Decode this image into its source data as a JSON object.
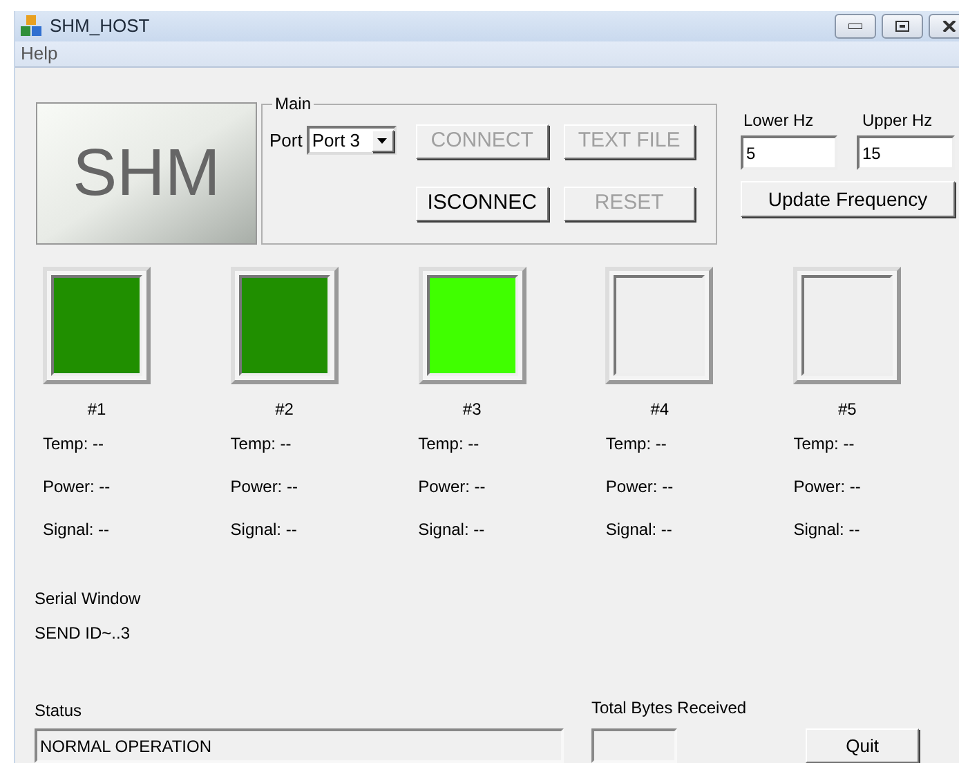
{
  "window": {
    "title": "SHM_HOST"
  },
  "menu": [
    "Help"
  ],
  "logo_button": {
    "label": "SHM"
  },
  "main_group": {
    "title": "Main",
    "port_label": "Port",
    "port_value": "Port 3",
    "buttons": [
      {
        "label": "CONNECT",
        "disabled": true
      },
      {
        "label": "TEXT FILE",
        "disabled": true
      },
      {
        "label": "ISCONNEC",
        "disabled": false
      },
      {
        "label": "RESET",
        "disabled": true
      }
    ]
  },
  "frequency": {
    "lower_label": "Lower Hz",
    "lower_value": "5",
    "upper_label": "Upper Hz",
    "upper_value": "15",
    "button": "Update Frequency"
  },
  "sensors": [
    {
      "name": "#1",
      "color": "#208f00",
      "temp": "Temp: --",
      "power": "Power: --",
      "signal": "Signal: --"
    },
    {
      "name": "#2",
      "color": "#208f00",
      "temp": "Temp: --",
      "power": "Power: --",
      "signal": "Signal: --"
    },
    {
      "name": "#3",
      "color": "#40ff00",
      "temp": "Temp: --",
      "power": "Power: --",
      "signal": "Signal: --"
    },
    {
      "name": "#4",
      "color": "#efefef",
      "temp": "Temp: --",
      "power": "Power: --",
      "signal": "Signal: --"
    },
    {
      "name": "#5",
      "color": "#efefef",
      "temp": "Temp: --",
      "power": "Power: --",
      "signal": "Signal: --"
    }
  ],
  "serial_window": {
    "label": "Serial Window",
    "text": "SEND ID~..3"
  },
  "status": {
    "label": "Status",
    "value": "NORMAL OPERATION"
  },
  "total_bytes": {
    "label": "Total Bytes Received"
  },
  "quit_button": "Quit"
}
